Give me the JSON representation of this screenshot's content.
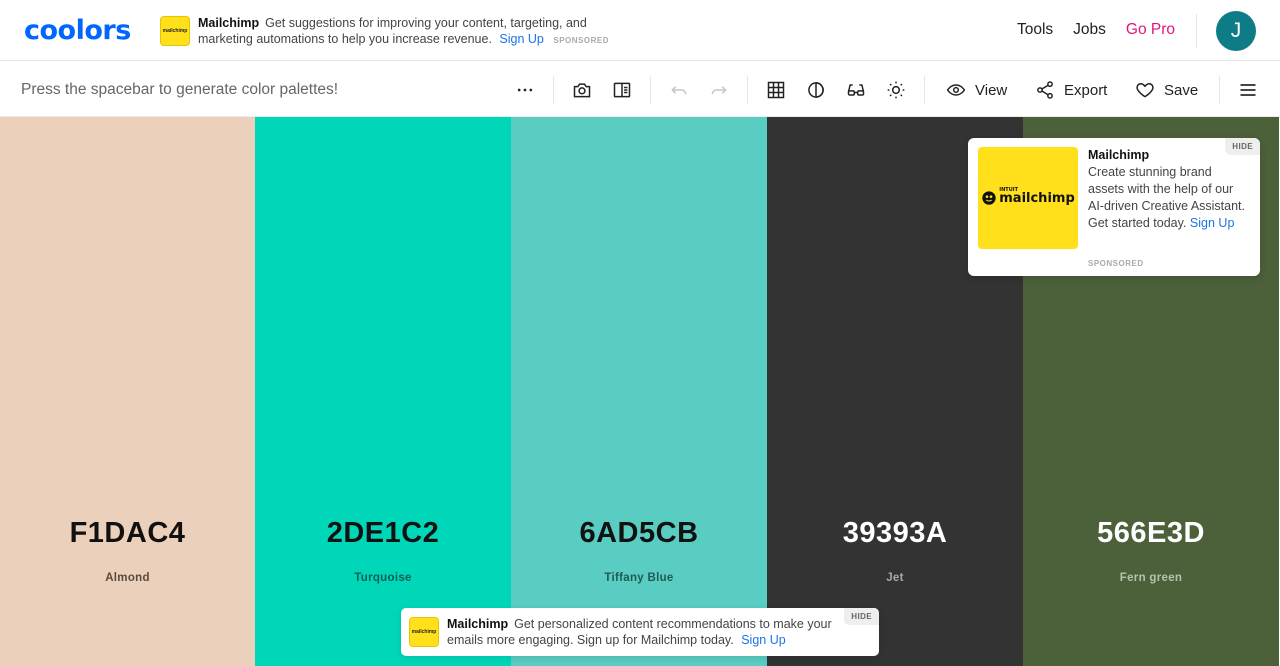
{
  "header": {
    "logo": "coolors",
    "ad": {
      "brand": "Mailchimp",
      "text": "Get suggestions for improving your content, targeting, and marketing automations to help you increase revenue.",
      "link": "Sign Up",
      "sponsored": "SPONSORED",
      "logo_text": "mailchimp"
    },
    "nav": {
      "tools": "Tools",
      "jobs": "Jobs",
      "pro": "Go Pro"
    },
    "avatar_initial": "J"
  },
  "toolbar": {
    "hint": "Press the spacebar to generate color palettes!",
    "view_label": "View",
    "export_label": "Export",
    "save_label": "Save",
    "icons": [
      "more-icon",
      "camera-icon",
      "layout-icon",
      "undo-icon",
      "redo-icon",
      "grid-icon",
      "contrast-icon",
      "glasses-icon",
      "sun-icon",
      "eye-icon",
      "share-icon",
      "heart-icon",
      "menu-icon"
    ]
  },
  "palette": [
    {
      "hex": "F1DAC4",
      "name": "Almond",
      "bg": "#EBD0BC",
      "text_color": "#111111",
      "name_color": "#5a4a3f"
    },
    {
      "hex": "2DE1C2",
      "name": "Turquoise",
      "bg": "#00D7B9",
      "text_color": "#111111",
      "name_color": "#0b5e51"
    },
    {
      "hex": "6AD5CB",
      "name": "Tiffany Blue",
      "bg": "#5ACDC3",
      "text_color": "#111111",
      "name_color": "#1f5a55"
    },
    {
      "hex": "39393A",
      "name": "Jet",
      "bg": "#333333",
      "text_color": "#ffffff",
      "name_color": "#a9a9a9"
    },
    {
      "hex": "566E3D",
      "name": "Fern green",
      "bg": "#4C603A",
      "text_color": "#ffffff",
      "name_color": "#b7c2ac"
    }
  ],
  "side_ad": {
    "title": "Mailchimp",
    "body": "Create stunning brand assets with the help of our AI-driven Creative Assistant. Get started today.",
    "link": "Sign Up",
    "sponsored": "SPONSORED",
    "hide": "HIDE",
    "logo_small": "INTUIT",
    "logo_text": "mailchimp"
  },
  "bottom_ad": {
    "brand": "Mailchimp",
    "text": "Get personalized content recommendations to make your emails more engaging. Sign up for Mailchimp today.",
    "link": "Sign Up",
    "hide": "HIDE",
    "logo_text": "mailchimp"
  }
}
